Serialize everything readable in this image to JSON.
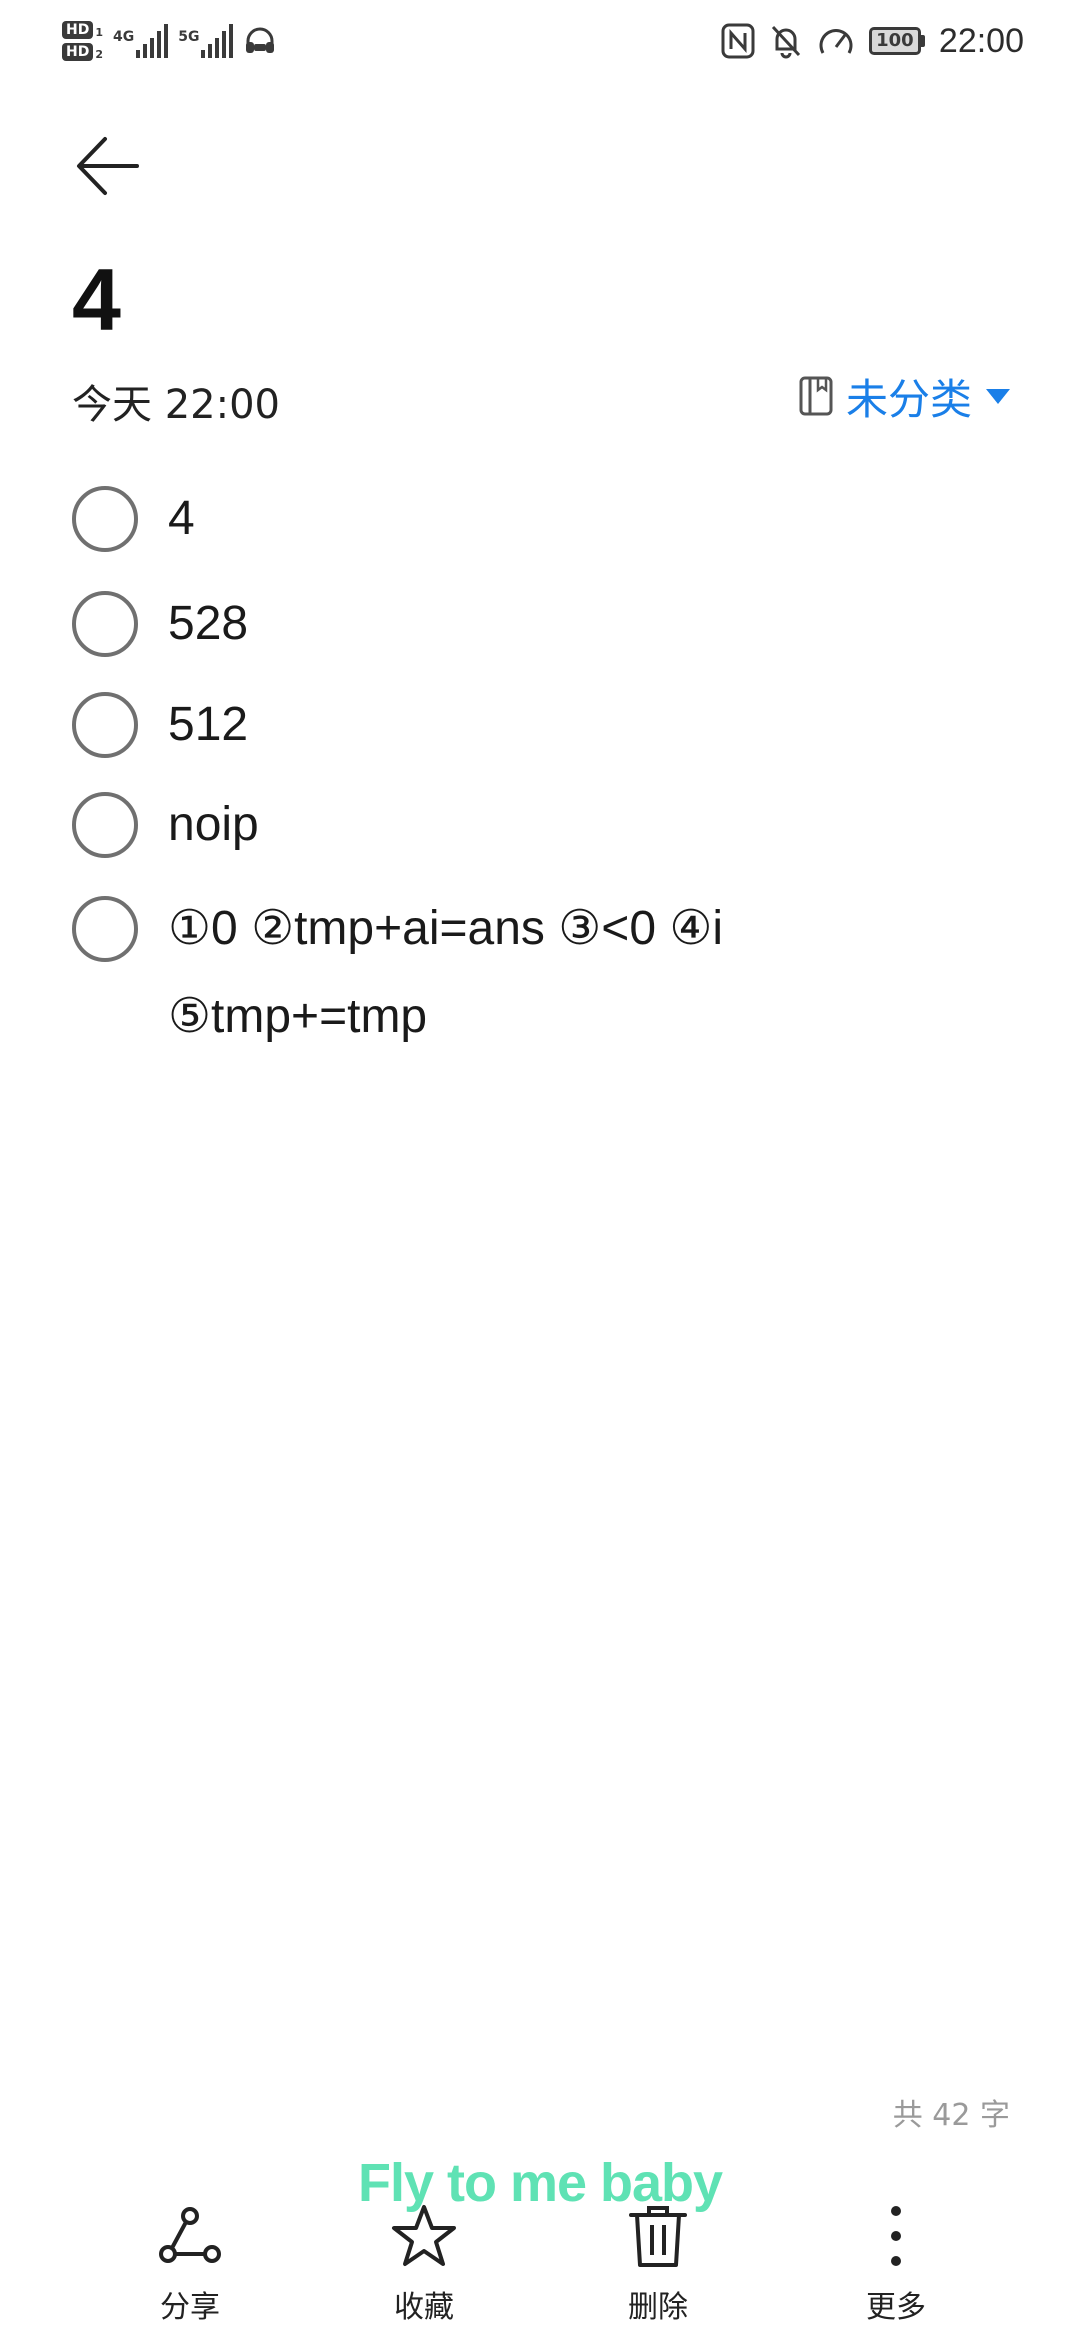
{
  "status_bar": {
    "hd1": "HD",
    "hd1_sub": "1",
    "hd2": "HD",
    "hd2_sub": "2",
    "net1": "4G",
    "net2": "5G",
    "battery": "100",
    "time": "22:00",
    "icons": [
      "nfc-icon",
      "mute-icon",
      "speed-icon",
      "battery-icon"
    ]
  },
  "note": {
    "title": "4",
    "date": "今天 22:00",
    "category": "未分类",
    "checklist": [
      {
        "text": "4",
        "checked": false
      },
      {
        "text": "528",
        "checked": false
      },
      {
        "text": "512",
        "checked": false
      },
      {
        "text": "noip",
        "checked": false
      },
      {
        "text": "①0 ②tmp+ai=ans ③<0 ④i ⑤tmp+=tmp",
        "checked": false
      }
    ],
    "word_count": "共 42 字"
  },
  "lyric": "Fly to me baby",
  "toolbar": {
    "share": "分享",
    "favorite": "收藏",
    "delete": "删除",
    "more": "更多"
  },
  "colors": {
    "accent": "#1a7fe8",
    "lyric": "#5fe2b4"
  }
}
